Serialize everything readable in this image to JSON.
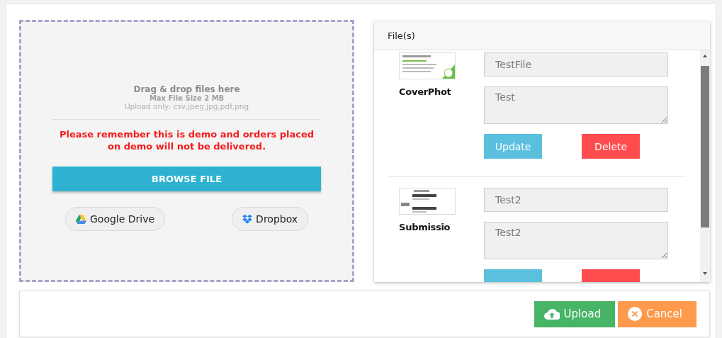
{
  "dropzone": {
    "title": "Drag & drop files here",
    "max_size": "Max File Size 2 MB",
    "allowed": "Upload only: csv,jpeg,jpg,pdf,png",
    "warning": "Please remember this is demo and orders placed on demo will not be delivered.",
    "browse_button": "BROWSE FILE",
    "sources": [
      {
        "kind": "drive",
        "label": "Google Drive"
      },
      {
        "kind": "dropbox",
        "label": "Dropbox"
      }
    ]
  },
  "files_panel": {
    "title": "File(s)",
    "files": [
      {
        "name": "CoverPhot",
        "title": "TestFile",
        "description": "Test",
        "actions": [
          {
            "kind": "update",
            "label": "Update"
          },
          {
            "kind": "delete",
            "label": "Delete"
          }
        ]
      },
      {
        "name": "Submissio",
        "title": "Test2",
        "description": "Test2",
        "actions": [
          {
            "kind": "update"
          },
          {
            "kind": "delete"
          }
        ]
      }
    ]
  },
  "footer": {
    "buttons": [
      {
        "kind": "upload",
        "label": "Upload"
      },
      {
        "kind": "cancel",
        "label": "Cancel"
      }
    ]
  }
}
